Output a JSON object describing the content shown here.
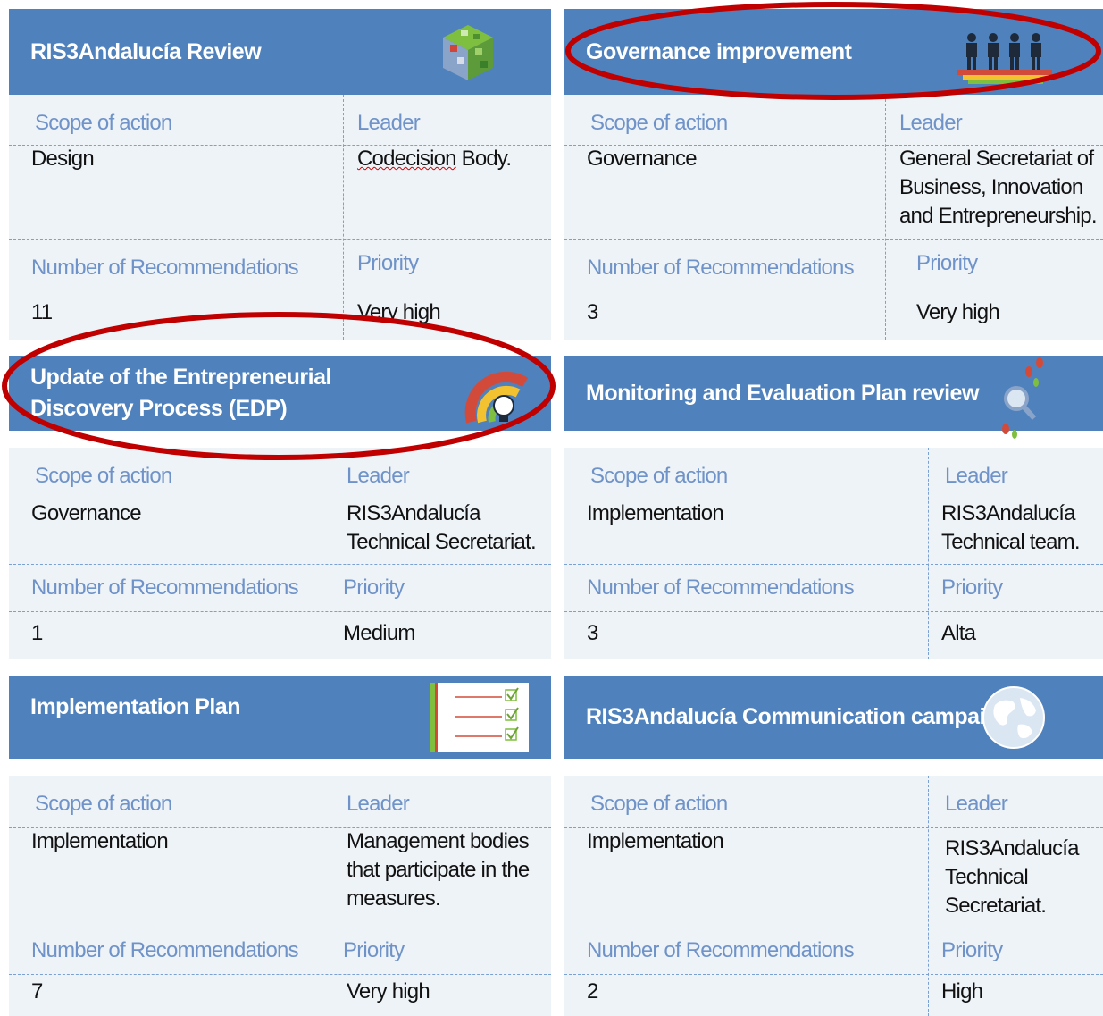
{
  "labels": {
    "scope": "Scope of action",
    "leader": "Leader",
    "recs": "Number of Recommendations",
    "priority": "Priority"
  },
  "cards": [
    {
      "title": "RIS3Andalucía Review",
      "icon": "rubiks-cube-icon",
      "scope": "Design",
      "leader_pre": "",
      "leader_mark": "Codecision",
      "leader_post": " Body.",
      "recommendations": "11",
      "priority": "Very high"
    },
    {
      "title": "Governance improvement",
      "icon": "people-icon",
      "scope": "Governance",
      "leader": "General Secretariat of Business, Innovation and Entrepreneurship.",
      "recommendations": "3",
      "priority": "Very high"
    },
    {
      "title": "Update of the Entrepreneurial Discovery Process (EDP)",
      "icon": "lightbulb-gauge-icon",
      "scope": "Governance",
      "leader": "RIS3Andalucía Technical Secretariat.",
      "recommendations": "1",
      "priority": "Medium"
    },
    {
      "title": "Monitoring and Evaluation Plan review",
      "icon": "magnifier-footprints-icon",
      "scope": "Implementation",
      "leader": "RIS3Andalucía Technical team.",
      "recommendations": "3",
      "priority": "Alta"
    },
    {
      "title": "Implementation Plan",
      "icon": "checklist-icon",
      "scope": "Implementation",
      "leader": "Management bodies that participate in the measures.",
      "recommendations": "7",
      "priority": "Very high"
    },
    {
      "title": "RIS3Andalucía Communication campaigns",
      "icon": "globe-icon",
      "scope": "Implementation",
      "leader": "RIS3Andalucía Technical Secretariat.",
      "recommendations": "2",
      "priority": "High"
    }
  ],
  "colors": {
    "header": "#4f81bd",
    "body": "#eef3f8",
    "label": "#6f93c8",
    "highlight_ellipse": "#c00000"
  }
}
